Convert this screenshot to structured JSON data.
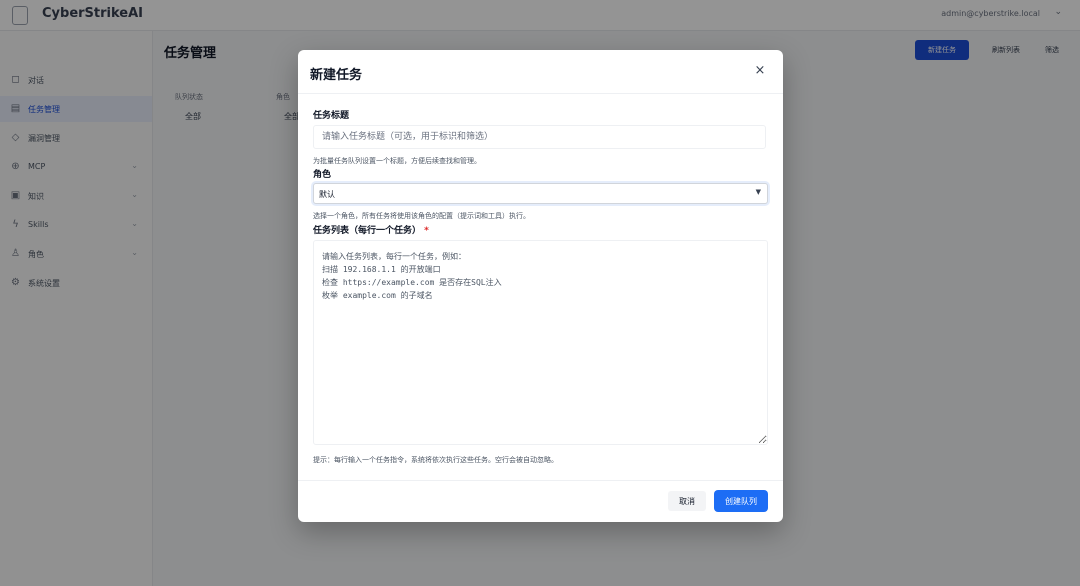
{
  "app": {
    "title": "CyberStrikeAI",
    "user_text": "admin@cyberstrike.local",
    "main_title": "任务管理",
    "header_actions": {
      "primary": "新建任务",
      "secondary": "刷新列表",
      "tertiary": "筛选"
    },
    "filters": [
      {
        "label": "队列状态",
        "value": "全部"
      },
      {
        "label": "角色",
        "value": "全部"
      }
    ]
  },
  "sidebar": {
    "items": [
      {
        "label": "对话",
        "icon": "chat-icon",
        "active": false,
        "has_chevron": false
      },
      {
        "label": "任务管理",
        "icon": "tasks-icon",
        "active": true,
        "has_chevron": false
      },
      {
        "label": "漏洞管理",
        "icon": "shield-icon",
        "active": false,
        "has_chevron": false
      },
      {
        "label": "MCP",
        "icon": "plug-icon",
        "active": false,
        "has_chevron": true
      },
      {
        "label": "知识",
        "icon": "book-icon",
        "active": false,
        "has_chevron": true
      },
      {
        "label": "Skills",
        "icon": "bolt-icon",
        "active": false,
        "has_chevron": true
      },
      {
        "label": "角色",
        "icon": "user-icon",
        "active": false,
        "has_chevron": true
      },
      {
        "label": "系统设置",
        "icon": "gear-icon",
        "active": false,
        "has_chevron": false
      }
    ]
  },
  "modal": {
    "title": "新建任务",
    "close_symbol": "×",
    "task_title": {
      "label": "任务标题",
      "placeholder": "请输入任务标题（可选，用于标识和筛选）",
      "value": "",
      "hint": "为批量任务队列设置一个标题，方便后续查找和管理。"
    },
    "role": {
      "label": "角色",
      "value": "默认",
      "hint": "选择一个角色，所有任务将使用该角色的配置（提示词和工具）执行。"
    },
    "task_list": {
      "label": "任务列表（每行一个任务）",
      "required_mark": "*",
      "placeholder": "请输入任务列表，每行一个任务，例如：\n扫描 192.168.1.1 的开放端口\n检查 https://example.com 是否存在SQL注入\n枚举 example.com 的子域名",
      "hint": "提示：每行输入一个任务指令，系统将依次执行这些任务。空行会被自动忽略。"
    },
    "cancel_label": "取消",
    "create_label": "创建队列"
  },
  "colors": {
    "primary": "#1d6df5",
    "overlay": "rgba(0,0,0,0.42)",
    "required": "#dc2626"
  }
}
